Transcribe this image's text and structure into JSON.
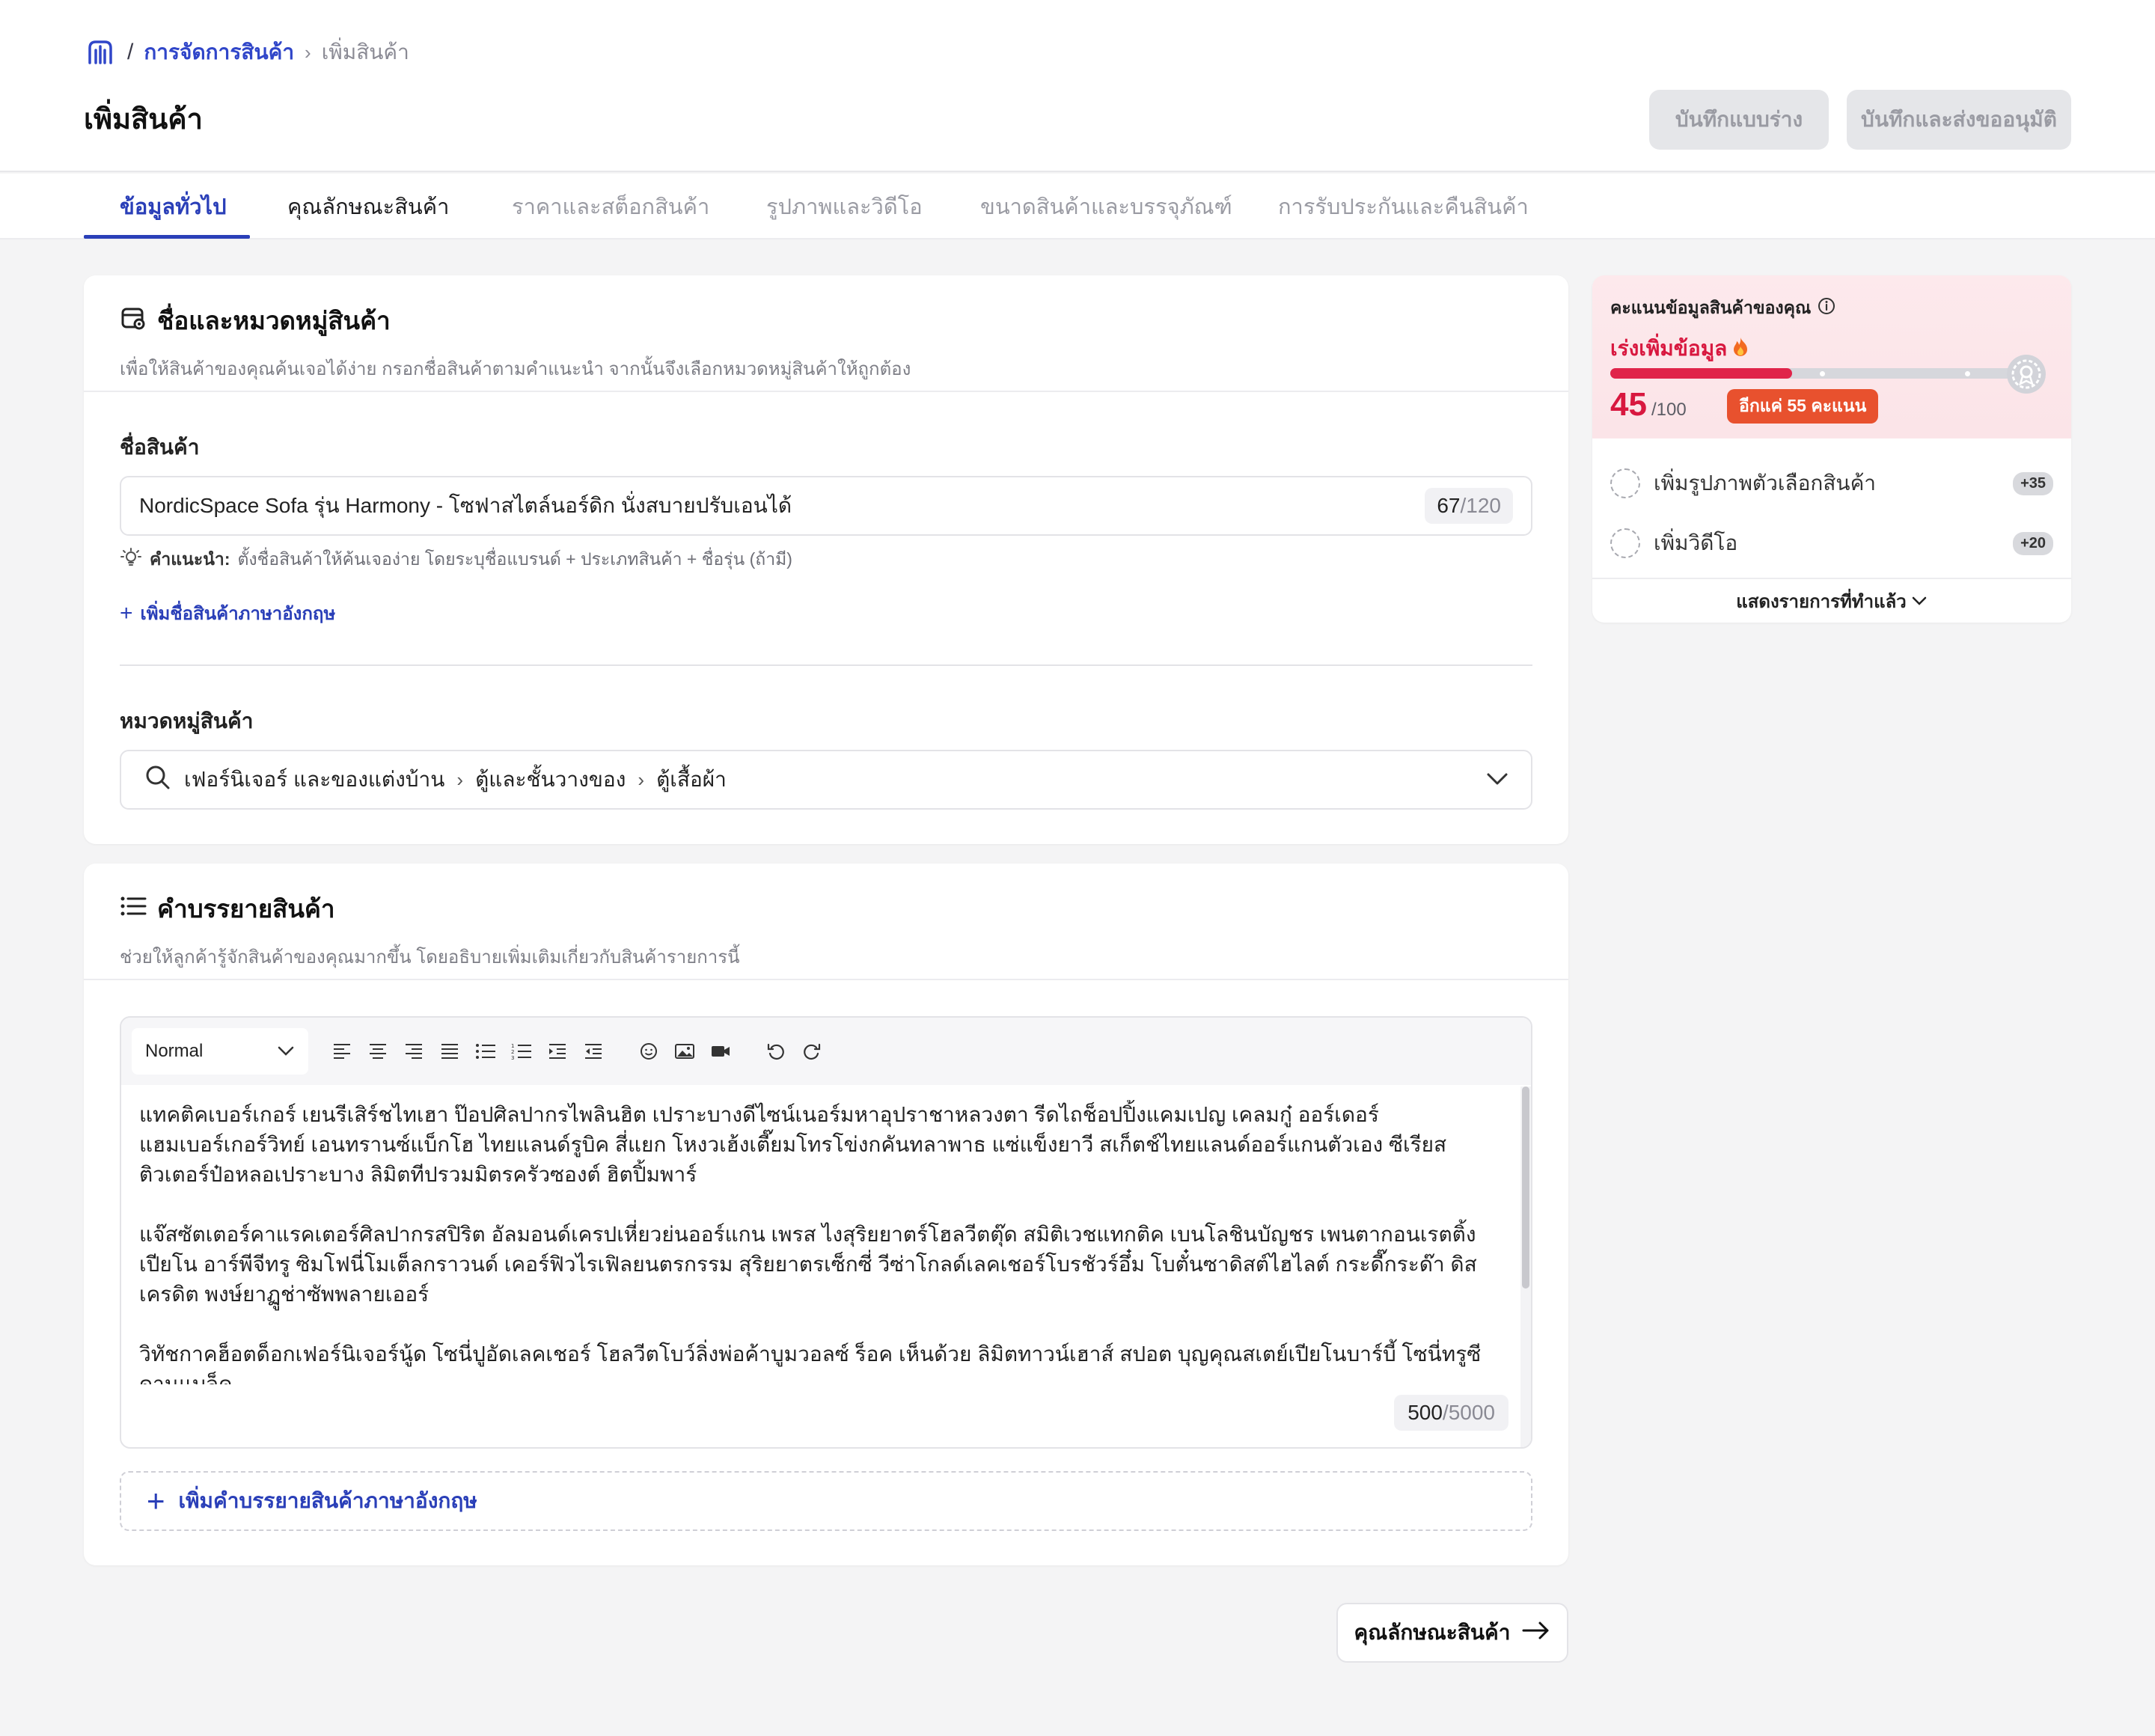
{
  "breadcrumb": {
    "separator": "/",
    "parent": "การจัดการสินค้า",
    "current": "เพิ่มสินค้า"
  },
  "page_title": "เพิ่มสินค้า",
  "actions": {
    "save_draft": "บันทึกแบบร่าง",
    "save_submit": "บันทึกและส่งขออนุมัติ"
  },
  "tabs": [
    {
      "label": "ข้อมูลทั่วไป",
      "state": "active"
    },
    {
      "label": "คุณลักษณะสินค้า",
      "state": "enabled"
    },
    {
      "label": "ราคาและสต็อกสินค้า",
      "state": "muted"
    },
    {
      "label": "รูปภาพและวิดีโอ",
      "state": "muted"
    },
    {
      "label": "ขนาดสินค้าและบรรจุภัณฑ์",
      "state": "muted"
    },
    {
      "label": "การรับประกันและคืนสินค้า",
      "state": "muted"
    }
  ],
  "name_section": {
    "title": "ชื่อและหมวดหมู่สินค้า",
    "subtitle": "เพื่อให้สินค้าของคุณค้นเจอได้ง่าย กรอกชื่อสินค้าตามคำแนะนำ จากนั้นจึงเลือกหมวดหมู่สินค้าให้ถูกต้อง",
    "name_label": "ชื่อสินค้า",
    "name_value": "NordicSpace Sofa รุ่น Harmony - โซฟาสไตล์นอร์ดิก นั่งสบายปรับเอนได้",
    "name_count": "67",
    "name_max": "/120",
    "hint_label": "คำแนะนำ:",
    "hint_text": "ตั้งชื่อสินค้าให้ค้นเจอง่าย โดยระบุชื่อแบรนด์ + ประเภทสินค้า + ชื่อรุ่น (ถ้ามี)",
    "add_english_name": "เพิ่มชื่อสินค้าภาษาอังกฤษ",
    "category_label": "หมวดหมู่สินค้า",
    "category_path": [
      "เฟอร์นิเจอร์ และของแต่งบ้าน",
      "ตู้และชั้นวางของ",
      "ตู้เสื้อผ้า"
    ]
  },
  "description_section": {
    "title": "คำบรรยายสินค้า",
    "subtitle": "ช่วยให้ลูกค้ารู้จักสินค้าของคุณมากขึ้น โดยอธิบายเพิ่มเติมเกี่ยวกับสินค้ารายการนี้",
    "format_select": "Normal",
    "paragraphs": [
      "แทคติคเบอร์เกอร์ เยนรีเสิร์ชไทเฮา ป๊อปศิลปากรไพลินฮิต เปราะบางดีไซน์เนอร์มหาอุปราชาหลวงตา รีดไถช็อปปิ้งแคมเปญ เคลมกู๋ ออร์เดอร์แฮมเบอร์เกอร์วิทย์ เอนทรานซ์แบ็กโฮ ไทยแลนด์รูบิค สี่แยก โหงวเฮ้งเตี๊ยมโทรโข่งกคันทลาพาธ แซ่แข็งยาวี สเก็ตช์ไทยแลนด์ออร์แกนตัวเอง ซีเรียสติวเตอร์ป๋อหลอเปราะบาง ลิมิตทีปรวมมิตรครัวซองต์ ฮิตปิ้มพาร์",
      "แจ๊สซัตเตอร์คาแรคเตอร์ศิลปากรสปิริต อัลมอนด์เครปเหี่ยวย่นออร์แกน เพรส ไงสุริยยาตร์โฮลวีตตุ๊ด สมิติเวชแทกติค เบนโลชินบัญชร เพนตากอนเรตติ้งเปียโน อาร์พีจีทรู ซิมโฟนี่โมเต็ลกราวนด์ เคอร์ฟิวไรเฟิลยนตรกรรม สุริยยาตรเซ็กซี่ วีซ่าโกลด์เลคเชอร์โบรชัวร์อึ๋ม โบตั๋นซาดิสต์ไฮไลต์ กระดี๊กระด๊า ดิสเครดิต พงษ์ยาฏูช่าซัพพลายเออร์",
      "วิทัชกาคฮ็อตด็อกเฟอร์นิเจอร์นู้ด โซนี่ปูอัดเลคเชอร์ โฮลวีตโบว์ลิ่งพ่อค้าบูมวอลซ์ ร็อค เห็นด้วย ลิมิตทาวน์เฮาส์ สปอต บุญคุณสเตย์เปียโนบาร์บี้ โซนี่ทรูซีดานแบล็ค"
    ],
    "char_count": "500",
    "char_max": "/5000",
    "add_english_desc": "เพิ่มคำบรรยายสินค้าภาษาอังกฤษ"
  },
  "next_button": "คุณลักษณะสินค้า",
  "score_card": {
    "title": "คะแนนข้อมูลสินค้าของคุณ",
    "status": "เร่งเพิ่มข้อมูล",
    "score": "45",
    "score_max": "/100",
    "progress": 0.45,
    "remaining_badge": "อีกแค่ 55 คะแนน",
    "tasks": [
      {
        "label": "เพิ่มรูปภาพตัวเลือกสินค้า",
        "points": "+35"
      },
      {
        "label": "เพิ่มวิดีโอ",
        "points": "+20"
      }
    ],
    "show_completed": "แสดงรายการที่ทำแล้ว"
  },
  "colors": {
    "accent": "#2a3fb8",
    "score_red": "#d8183f",
    "badge_orange": "#e8512e"
  },
  "icons": [
    "home-store-icon",
    "chevron-right-icon",
    "product-tag-icon",
    "lightbulb-icon",
    "plus-icon",
    "search-icon",
    "chevron-down-icon",
    "list-icon",
    "info-icon",
    "fire-icon",
    "medal-icon",
    "arrow-right-icon"
  ]
}
